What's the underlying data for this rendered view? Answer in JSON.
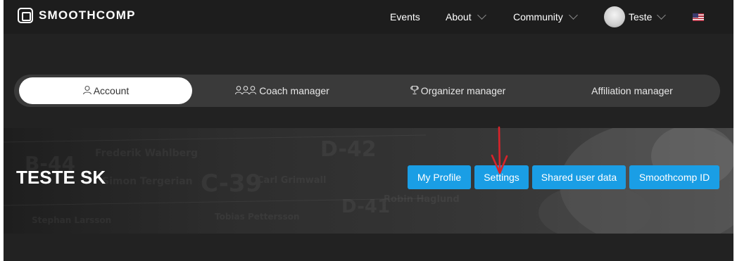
{
  "brand": {
    "name": "SMOOTHCOMP"
  },
  "nav": {
    "events": "Events",
    "about": "About",
    "community": "Community",
    "user_name": "Teste",
    "language_icon": "us-flag-icon"
  },
  "tabs": [
    {
      "label": "Account",
      "icon": "user-icon",
      "active": true
    },
    {
      "label": "Coach manager",
      "icon": "users-group-icon",
      "active": false
    },
    {
      "label": "Organizer manager",
      "icon": "trophy-icon",
      "active": false
    },
    {
      "label": "Affiliation manager",
      "icon": "",
      "active": false
    }
  ],
  "profile": {
    "title": "TESTE SK",
    "buttons": [
      "My Profile",
      "Settings",
      "Shared user data",
      "Smoothcomp ID"
    ]
  },
  "colors": {
    "accent": "#1a9ee5",
    "annotation": "#d8232a",
    "background": "#222222"
  }
}
